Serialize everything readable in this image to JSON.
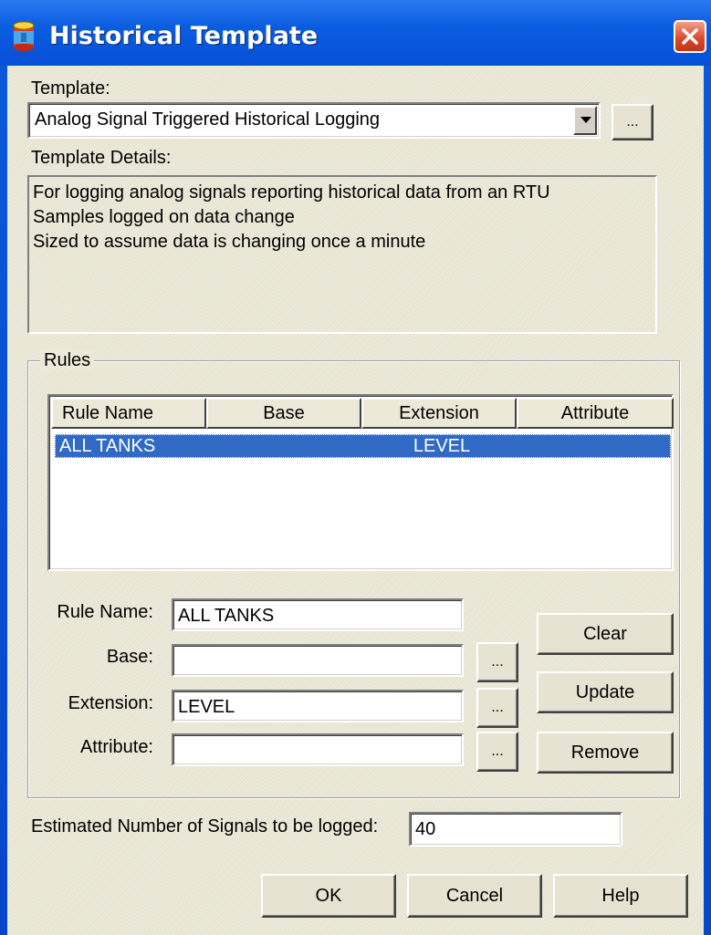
{
  "window": {
    "title": "Historical Template"
  },
  "template": {
    "label": "Template:",
    "selected": "Analog Signal Triggered Historical Logging",
    "browse_label": "..."
  },
  "details": {
    "label": "Template Details:",
    "lines": [
      "For logging analog signals reporting historical data from an RTU",
      "Samples logged on data change",
      "Sized to assume data is changing once a minute"
    ]
  },
  "rules": {
    "group_label": "Rules",
    "columns": [
      "Rule Name",
      "Base",
      "Extension",
      "Attribute"
    ],
    "rows": [
      {
        "rule_name": "ALL TANKS",
        "base": "",
        "extension": "LEVEL",
        "attribute": ""
      }
    ]
  },
  "form": {
    "rule_name_label": "Rule Name:",
    "rule_name_value": "ALL TANKS",
    "base_label": "Base:",
    "base_value": "",
    "extension_label": "Extension:",
    "extension_value": "LEVEL",
    "attribute_label": "Attribute:",
    "attribute_value": "",
    "browse_label": "..."
  },
  "side_buttons": {
    "clear": "Clear",
    "update": "Update",
    "remove": "Remove"
  },
  "estimate": {
    "label": "Estimated Number of Signals to be logged:",
    "value": "40"
  },
  "footer": {
    "ok": "OK",
    "cancel": "Cancel",
    "help": "Help"
  },
  "colors": {
    "title_bar": "#0650d6",
    "dialog_face": "#ece9d8",
    "selection": "#316ac5",
    "close_button": "#d8462a"
  },
  "icons": {
    "app": "database-cylinder-icon",
    "close": "close-icon",
    "dropdown": "chevron-down-icon"
  }
}
